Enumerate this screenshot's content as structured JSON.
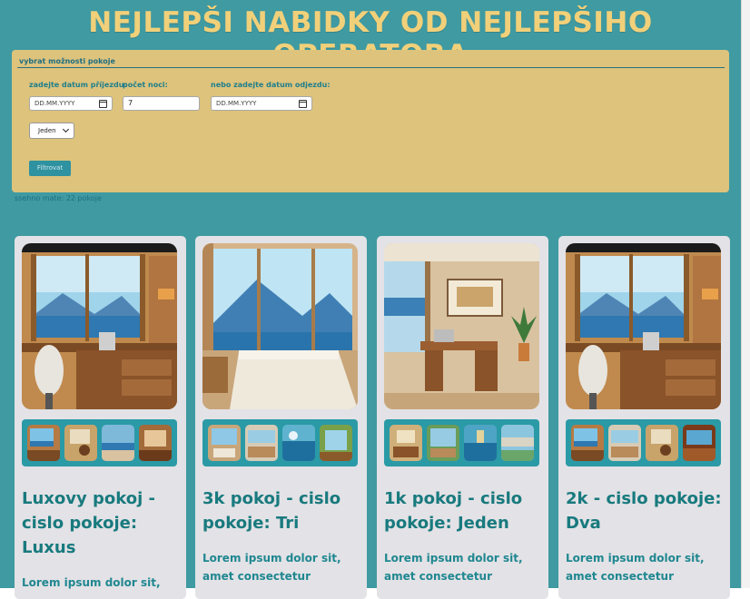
{
  "header": {
    "title": "Nejlepši nabidky od nejlepšiho operatora"
  },
  "filter": {
    "legend": "vybrat možnosti pokoje",
    "arrival_label": "zadejte datum příjezdu:",
    "arrival_placeholder": "DD.MM.YYYY",
    "nights_label": "počet noci:",
    "nights_value": "7",
    "departure_label": "nebo zadejte datum odjezdu:",
    "departure_placeholder": "DD.MM.YYYY",
    "select_value": "Jeden",
    "button_label": "Filtrovat"
  },
  "result_count": "ssehno mate: 22 pokoje",
  "cards": [
    {
      "title": "Luxovy pokoj - cislo pokoje: Luxus",
      "desc": "Lorem ipsum dolor sit,"
    },
    {
      "title": "3k pokoj - cislo pokoje: Tri",
      "desc": "Lorem ipsum dolor sit, amet consectetur"
    },
    {
      "title": "1k pokoj - cislo pokoje: Jeden",
      "desc": "Lorem ipsum dolor sit, amet consectetur"
    },
    {
      "title": "2k - cislo pokoje: Dva",
      "desc": "Lorem ipsum dolor sit, amet consectetur"
    }
  ]
}
